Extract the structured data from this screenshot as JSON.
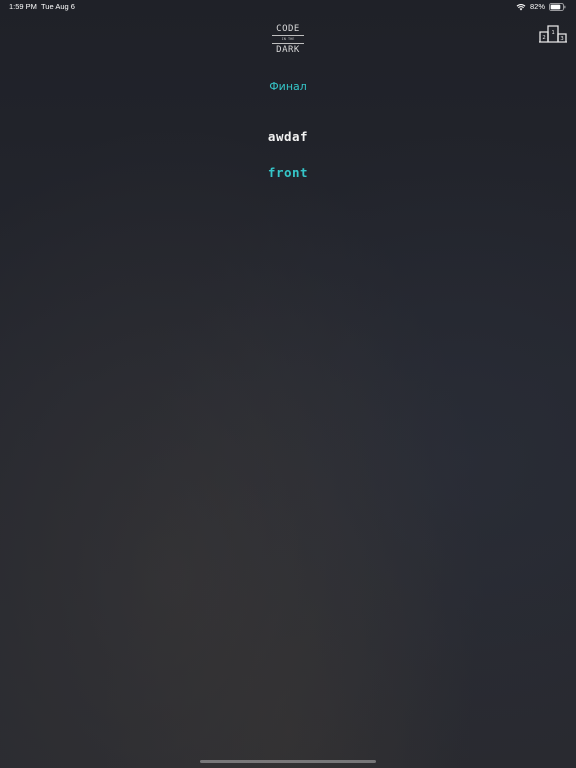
{
  "status_bar": {
    "time": "1:59 PM",
    "date": "Tue Aug 6",
    "battery_percent": "82%",
    "battery_level": 0.82,
    "wifi_icon": "wifi-icon",
    "battery_icon": "battery-icon"
  },
  "logo": {
    "top": "CODE",
    "middle": "IN THE",
    "bottom": "DARK"
  },
  "header": {
    "leaderboard_icon": "podium-icon"
  },
  "round": {
    "title": "Финал"
  },
  "players": [
    {
      "name": "awdaf",
      "color": "#f2f2f2"
    },
    {
      "name": "front",
      "color": "#35c6c9"
    }
  ],
  "colors": {
    "accent": "#35c6c9",
    "background": "#23252d"
  }
}
